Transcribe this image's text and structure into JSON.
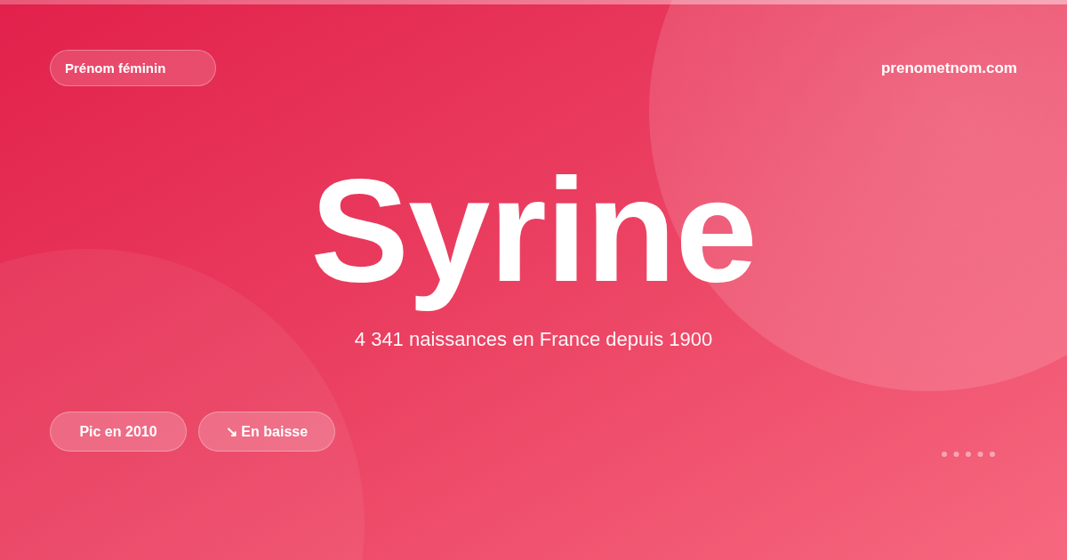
{
  "category_badge": "Prénom féminin",
  "site": "prenometnom.com",
  "name": "Syrine",
  "subtitle": "4 341 naissances en France depuis 1900",
  "badges": [
    "Pic en 2010",
    "↘ En baisse"
  ]
}
